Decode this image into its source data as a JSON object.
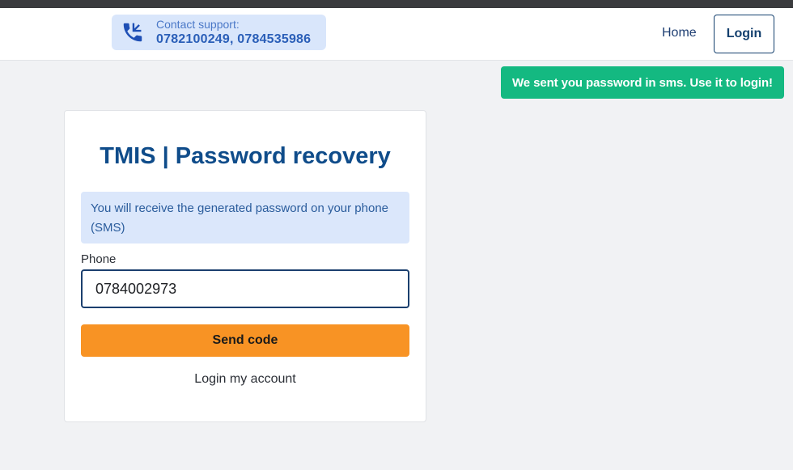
{
  "support": {
    "label": "Contact support:",
    "numbers": "0782100249, 0784535986"
  },
  "nav": {
    "home_label": "Home",
    "login_label": "Login"
  },
  "toast": {
    "message": "We sent you password in sms. Use it to login!"
  },
  "card": {
    "title": "TMIS | Password recovery",
    "info": "You will receive the generated password on your phone (SMS)",
    "phone_label": "Phone",
    "phone_value": "0784002973",
    "send_label": "Send code",
    "login_link": "Login my account"
  },
  "colors": {
    "accent": "#f89324",
    "brand": "#0f4c8a",
    "success": "#14b981",
    "info_bg": "#dbe7fb"
  },
  "icons": {
    "support": "phone-icon"
  }
}
